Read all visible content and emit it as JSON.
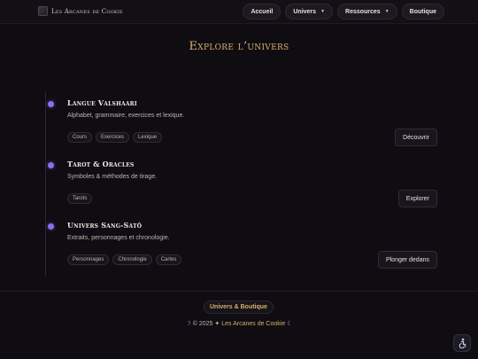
{
  "header": {
    "brand": "Les Arcanes de Cookie",
    "nav": [
      {
        "label": "Accueil"
      },
      {
        "label": "Univers",
        "dropdown": true
      },
      {
        "label": "Ressources",
        "dropdown": true
      },
      {
        "label": "Boutique"
      }
    ]
  },
  "page": {
    "title": "Explore l’univers"
  },
  "timeline": [
    {
      "title": "Langue Valshaari",
      "description": "Alphabet, grammaire, exercices et lexique.",
      "tags": [
        "Cours",
        "Exercices",
        "Lexique"
      ],
      "action": "Découvrir"
    },
    {
      "title": "Tarot & Oracles",
      "description": "Symboles & méthodes de tirage.",
      "tags": [
        "Tarots"
      ],
      "action": "Explorer"
    },
    {
      "title": "Univers Sang-Satô",
      "description": "Extraits, personnages et chronologie.",
      "tags": [
        "Personnages",
        "Chronologie",
        "Cartes"
      ],
      "action": "Plonger dedans"
    }
  ],
  "footer": {
    "pill": "Univers & Boutique",
    "moon_left": "☽",
    "copyright": "© 2025",
    "star": "✦",
    "brand": "Les Arcanes de Cookie",
    "moon_right": "☾"
  },
  "icons": {
    "fab": "accessibility-icon"
  },
  "colors": {
    "accent_gold": "#d9b06a",
    "accent_violet": "#8a6ff0",
    "background": "#0f0d12"
  }
}
